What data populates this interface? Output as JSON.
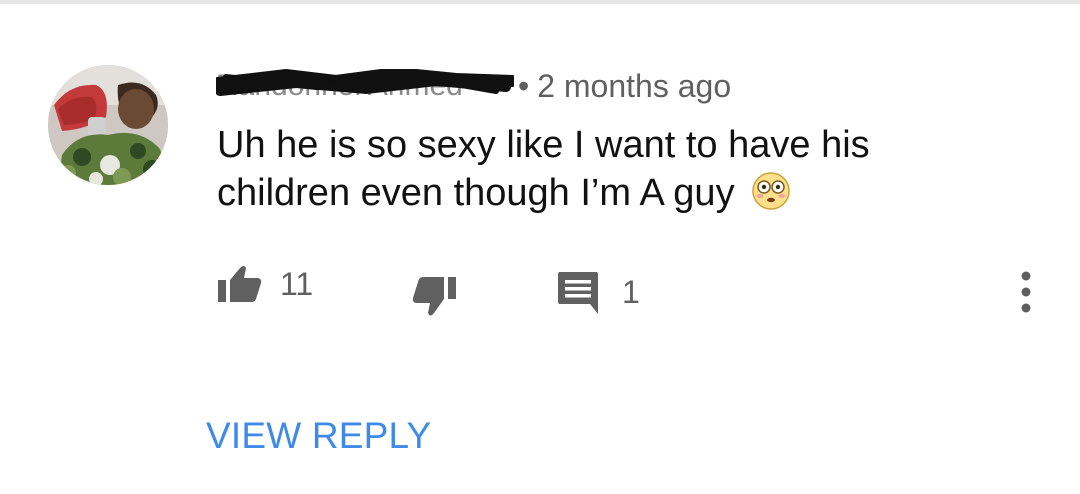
{
  "comment": {
    "author": "Randonnel Ahmed",
    "timestamp": "2 months ago",
    "separator": "•",
    "text_line1": "Uh he is so sexy like I  want to have his",
    "text_line2": "children even though I’m A guy",
    "emoji": "flushed-face"
  },
  "actions": {
    "like_count": "11",
    "reply_count": "1",
    "like_icon": "thumbs-up-icon",
    "dislike_icon": "thumbs-down-icon",
    "reply_icon": "comment-icon",
    "more_icon": "more-vertical-icon"
  },
  "view_reply": {
    "label": "VIEW REPLY",
    "color": "#3f8ae8"
  },
  "colors": {
    "text_primary": "#111111",
    "text_secondary": "#606060",
    "icon": "#606060",
    "link": "#3f8ae8"
  }
}
